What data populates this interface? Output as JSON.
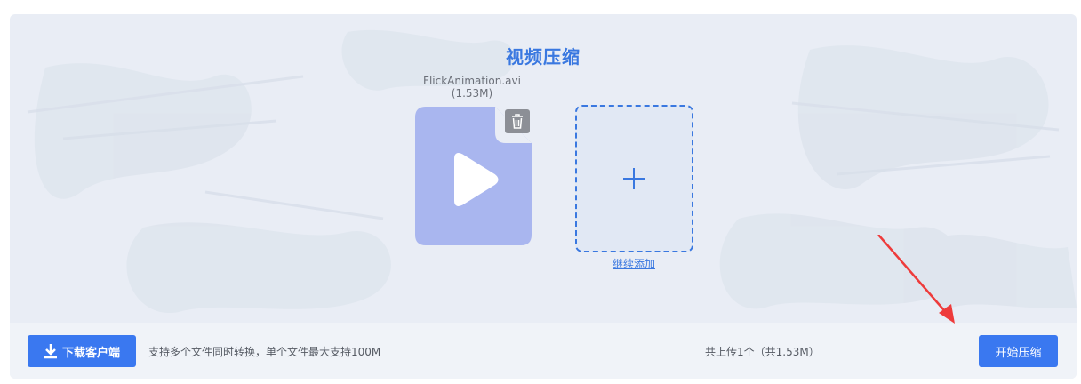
{
  "header": {
    "title": "视频压缩"
  },
  "file": {
    "name": "FlickAnimation.avi",
    "size": "(1.53M)",
    "icon": "video-file-icon"
  },
  "add": {
    "continue_label": "继续添加"
  },
  "footer": {
    "download_label": "下载客户端",
    "support_text": "支持多个文件同时转换，单个文件最大支持100M",
    "uploaded_text": "共上传1个（共1.53M）",
    "start_label": "开始压缩"
  },
  "colors": {
    "accent": "#3a78f0",
    "file_card": "#a9b6ef",
    "annotation_arrow": "#ee3b3b"
  }
}
